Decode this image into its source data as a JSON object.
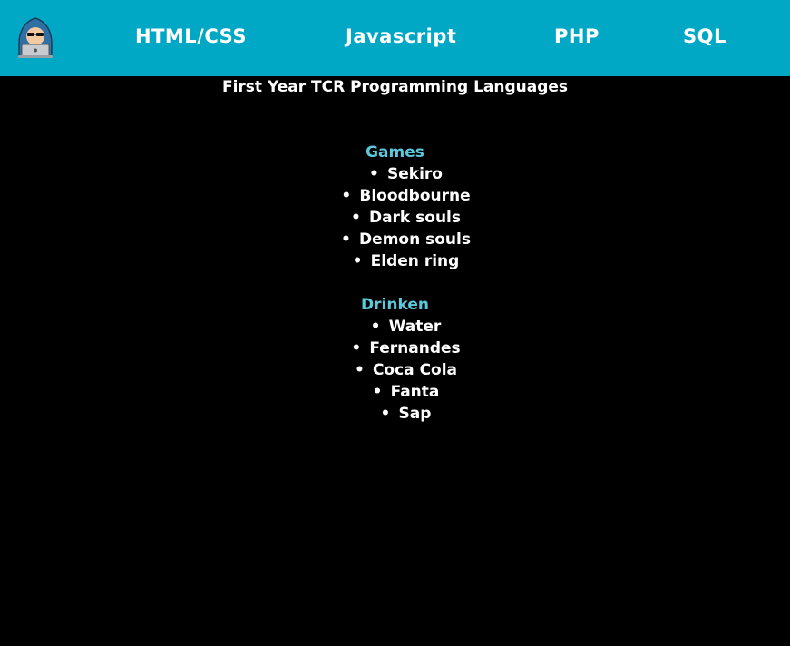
{
  "nav": {
    "links": [
      {
        "label": "HTML/CSS"
      },
      {
        "label": "Javascript"
      },
      {
        "label": "PHP"
      },
      {
        "label": "SQL"
      }
    ]
  },
  "title": "First Year TCR Programming Languages",
  "sections": [
    {
      "heading": "Games",
      "items": [
        "Sekiro",
        "Bloodbourne",
        "Dark souls",
        "Demon souls",
        "Elden ring"
      ]
    },
    {
      "heading": "Drinken",
      "items": [
        "Water",
        "Fernandes",
        "Coca Cola",
        "Fanta",
        "Sap"
      ]
    }
  ],
  "colors": {
    "nav_background": "#00a8c6",
    "page_background": "#000000",
    "heading": "#5bc8dc",
    "text": "#ffffff"
  },
  "icons": {
    "logo": "hacker-hoodie-laptop-icon"
  }
}
